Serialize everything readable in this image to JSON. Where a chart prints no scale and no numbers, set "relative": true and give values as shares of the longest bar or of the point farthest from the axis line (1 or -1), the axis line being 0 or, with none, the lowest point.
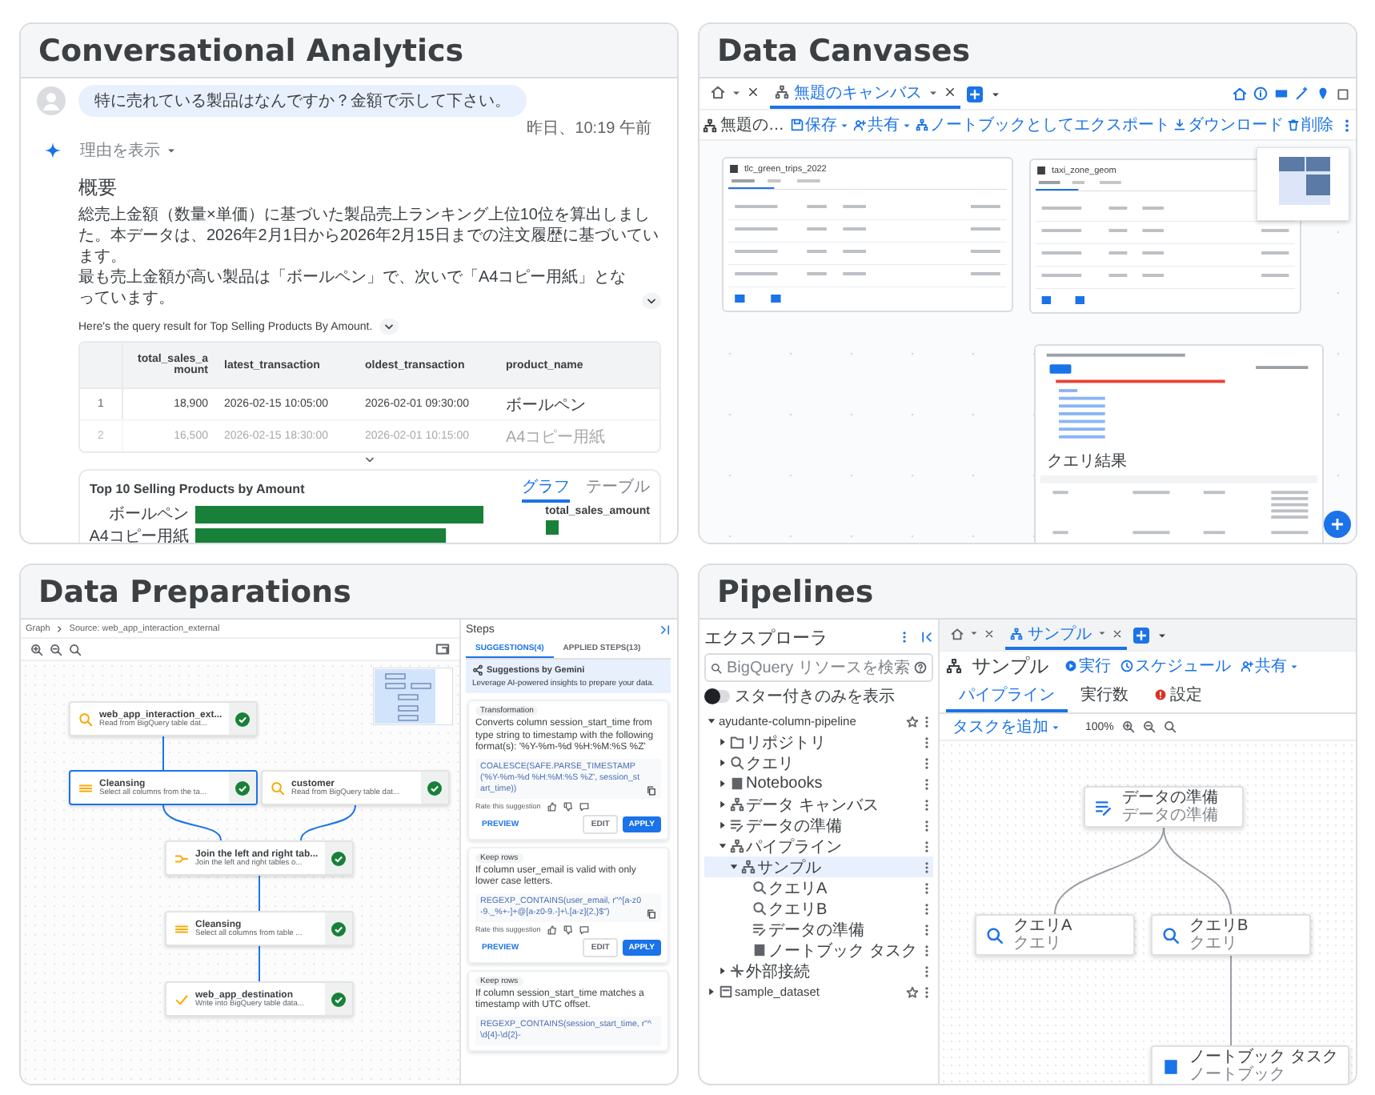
{
  "conversational_analytics": {
    "title": "Conversational Analytics",
    "user_message": "特に売れている製品はなんですか？金額で示して下さい。",
    "timestamp": "昨日、10:19 午前",
    "reasoning_toggle": {
      "label": "理由を表示",
      "expanded": false
    },
    "summary_heading": "概要",
    "summary_paragraphs": [
      "総売上金額（数量×単価）に基づいた製品売上ランキング上位10位を算出しました。本データは、2026年2月1日から2026年2月15日までの注文履歴に基づいています。",
      "最も売上金額が高い製品は「ボールペン」で、次いで「A4コピー用紙」となっています。"
    ],
    "query_note": "Here's the query result for Top Selling Products By Amount.",
    "table": {
      "collapsed": true,
      "columns": [
        "total_sales_amount",
        "latest_transaction",
        "oldest_transaction",
        "product_name"
      ],
      "rows": [
        {
          "index": "1",
          "cells": [
            "18,900",
            "2026-02-15 10:05:00",
            "2026-02-01 09:30:00",
            "ボールペン"
          ]
        },
        {
          "index": "2",
          "cells": [
            "16,500",
            "2026-02-15 18:30:00",
            "2026-02-01 10:15:00",
            "A4コピー用紙"
          ]
        }
      ]
    },
    "chart_panel": {
      "tabs": [
        {
          "label": "グラフ",
          "selected": true
        },
        {
          "label": "テーブル",
          "selected": false
        }
      ],
      "chart_data": {
        "type": "bar",
        "orientation": "horizontal",
        "relative": true,
        "title": "Top 10 Selling Products by Amount",
        "categories": [
          "ボールペン",
          "A4コピー用紙"
        ],
        "series": [
          {
            "name": "total_sales_amount",
            "color": "#188038",
            "values": [
              1,
              0.87
            ]
          }
        ]
      }
    }
  },
  "data_canvases": {
    "title": "Data Canvases",
    "tabs": [
      {
        "kind": "home",
        "selected": false
      },
      {
        "kind": "canvas",
        "label": "無題のキャンバス",
        "selected": true
      }
    ],
    "toolbar": {
      "title": "無題の…",
      "actions": [
        {
          "kind": "save",
          "label": "保存",
          "menu": true
        },
        {
          "kind": "share",
          "label": "共有",
          "menu": true
        },
        {
          "kind": "export",
          "label": "ノートブックとしてエクスポート",
          "menu": false
        },
        {
          "kind": "download",
          "label": "ダウンロード",
          "menu": false
        },
        {
          "kind": "delete",
          "label": "削除",
          "menu": false
        }
      ]
    },
    "nodes": [
      {
        "kind": "table",
        "title": "tlc_green_trips_2022"
      },
      {
        "kind": "table",
        "title": "taxi_zone_geom"
      },
      {
        "kind": "query",
        "title": "クエリ結果"
      }
    ]
  },
  "data_preparations": {
    "title": "Data Preparations",
    "breadcrumb": [
      "Graph",
      "Source: web_app_interaction_external"
    ],
    "nodes": [
      {
        "kind": "source",
        "title": "web_app_interaction_ext...",
        "subtitle": "Read from BigQuery table dat...",
        "selected": false
      },
      {
        "kind": "transform",
        "title": "Cleansing",
        "subtitle": "Select all columns from the ta...",
        "selected": true
      },
      {
        "kind": "source",
        "title": "customer",
        "subtitle": "Read from BigQuery table dat...",
        "selected": false
      },
      {
        "kind": "join",
        "title": "Join the left and right tab...",
        "subtitle": "Join the left and right tables o...",
        "selected": false
      },
      {
        "kind": "transform",
        "title": "Cleansing",
        "subtitle": "Select all columns from table ...",
        "selected": false
      },
      {
        "kind": "destination",
        "title": "web_app_destination",
        "subtitle": "Write into BigQuery table data...",
        "selected": false
      }
    ],
    "steps": {
      "title": "Steps",
      "tabs": [
        {
          "label": "SUGGESTIONS(4)",
          "selected": true
        },
        {
          "label": "APPLIED STEPS(13)",
          "selected": false
        }
      ],
      "gemini": {
        "title": "Suggestions by Gemini",
        "text": "Leverage AI-powered insights to prepare your data."
      },
      "suggestions": [
        {
          "tag": "Transformation",
          "text": "Converts column session_start_time from type string to timestamp with the following format(s): '%Y-%m-%d %H:%M:%S %Z'",
          "code": "COALESCE(SAFE.PARSE_TIMESTAMP('%Y-%m-%d %H:%M:%S %Z', session_start_time))",
          "rate_label": "Rate this suggestion",
          "actions": [
            "PREVIEW",
            "EDIT",
            "APPLY"
          ]
        },
        {
          "tag": "Keep rows",
          "text": "If column user_email is valid with only lower case letters.",
          "code": "REGEXP_CONTAINS(user_email, r\"^[a-z0-9._%+-]+@[a-z0-9.-]+\\.[a-z]{2,}$\")",
          "rate_label": "Rate this suggestion",
          "actions": [
            "PREVIEW",
            "EDIT",
            "APPLY"
          ]
        },
        {
          "tag": "Keep rows",
          "text": "If column session_start_time matches a timestamp with UTC offset.",
          "code": "REGEXP_CONTAINS(session_start_time, r\"^\\d{4}-\\d{2}-"
        }
      ]
    }
  },
  "pipelines": {
    "title": "Pipelines",
    "explorer": {
      "title": "エクスプローラ",
      "search_placeholder": "BigQuery リソースを検索",
      "starred_toggle": {
        "label": "スター付きのみを表示",
        "on": false
      },
      "tree": [
        {
          "kind": "project",
          "label": "ayudante-column-pipeline",
          "expanded": true,
          "starred": false,
          "selected": false,
          "children": [
            {
              "kind": "repository",
              "label": "リポジトリ",
              "expanded": false,
              "selected": false
            },
            {
              "kind": "query",
              "label": "クエリ",
              "expanded": false,
              "selected": false
            },
            {
              "kind": "notebook",
              "label": "Notebooks",
              "expanded": false,
              "selected": false
            },
            {
              "kind": "canvas",
              "label": "データ キャンバス",
              "expanded": false,
              "selected": false
            },
            {
              "kind": "prep",
              "label": "データの準備",
              "expanded": false,
              "selected": false
            },
            {
              "kind": "pipeline",
              "label": "パイプライン",
              "expanded": true,
              "selected": false,
              "children": [
                {
                  "kind": "pipeline",
                  "label": "サンプル",
                  "expanded": true,
                  "selected": true,
                  "children": [
                    {
                      "kind": "query",
                      "label": "クエリA",
                      "selected": false
                    },
                    {
                      "kind": "query",
                      "label": "クエリB",
                      "selected": false
                    },
                    {
                      "kind": "prep",
                      "label": "データの準備",
                      "selected": false
                    },
                    {
                      "kind": "notebook",
                      "label": "ノートブック タスク",
                      "selected": false
                    }
                  ]
                }
              ]
            },
            {
              "kind": "connection",
              "label": "外部接続",
              "expanded": false,
              "selected": false
            }
          ]
        },
        {
          "kind": "dataset",
          "label": "sample_dataset",
          "expanded": false,
          "starred": false,
          "selected": false
        }
      ]
    },
    "tabs": [
      {
        "kind": "home",
        "selected": false
      },
      {
        "kind": "pipeline",
        "label": "サンプル",
        "selected": true
      }
    ],
    "header": {
      "title": "サンプル",
      "actions": [
        {
          "kind": "run",
          "label": "実行",
          "menu": false
        },
        {
          "kind": "schedule",
          "label": "スケジュール",
          "menu": false
        },
        {
          "kind": "share",
          "label": "共有",
          "menu": true
        }
      ]
    },
    "subtabs": [
      {
        "label": "パイプライン",
        "selected": true,
        "alert": false
      },
      {
        "label": "実行数",
        "selected": false,
        "alert": false
      },
      {
        "label": "設定",
        "selected": false,
        "alert": true
      }
    ],
    "add_task": "タスクを追加",
    "zoom": "100%",
    "tasks": [
      {
        "kind": "prep",
        "title": "データの準備",
        "subtitle": "データの準備"
      },
      {
        "kind": "query",
        "title": "クエリA",
        "subtitle": "クエリ"
      },
      {
        "kind": "query",
        "title": "クエリB",
        "subtitle": "クエリ"
      },
      {
        "kind": "notebook",
        "title": "ノートブック タスク",
        "subtitle": "ノートブック"
      }
    ]
  }
}
